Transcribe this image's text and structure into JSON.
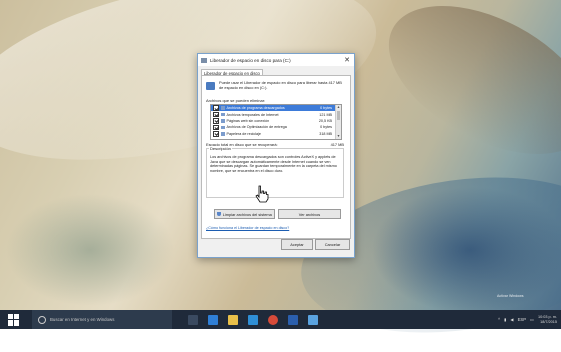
{
  "dialog": {
    "title": "Liberador de espacio en disco para (C:)",
    "close_glyph": "✕",
    "tab": "Liberador de espacio en disco",
    "info_text": "Puede usar el Liberador de espacio en disco para liberar hasta 417 MB de espacio en disco en (C:).",
    "list_label": "Archivos que se pueden eliminar:",
    "files": [
      {
        "name": "Archivos de programa descargados",
        "size": "0 bytes",
        "checked": true,
        "selected": true
      },
      {
        "name": "Archivos temporales de Internet",
        "size": "121 MB",
        "checked": true,
        "selected": false
      },
      {
        "name": "Páginas web sin conexión",
        "size": "20,5 KB",
        "checked": true,
        "selected": false
      },
      {
        "name": "Archivos de Optimización de entrega",
        "size": "0 bytes",
        "checked": true,
        "selected": false
      },
      {
        "name": "Papelera de reciclaje",
        "size": "318 MB",
        "checked": true,
        "selected": false
      }
    ],
    "total_label": "Espacio total en disco que se recuperará:",
    "total_value": "417 MB",
    "description_title": "Descripción",
    "description_text": "Los archivos de programa descargados son controles ActiveX y applets de Java que se descargan automáticamente desde Internet cuando se ven determinadas páginas. Se guardan temporalmente en la carpeta del mismo nombre, que se encuentra en el disco duro.",
    "clean_button": "Limpiar archivos del sistema",
    "view_button": "Ver archivos",
    "link": "¿Cómo funciona el Liberador de espacio en disco?",
    "ok_button": "Aceptar",
    "cancel_button": "Cancelar"
  },
  "taskbar": {
    "search_placeholder": "Buscar en Internet y en Windows",
    "language": "ESP",
    "time": "10:03 p. m.",
    "date": "18/7/2015",
    "apps": [
      {
        "name": "task-view-icon",
        "color": "#3a4a60"
      },
      {
        "name": "edge-icon",
        "color": "#2f7fd6"
      },
      {
        "name": "file-explorer-icon",
        "color": "#e8c04a"
      },
      {
        "name": "store-icon",
        "color": "#2f8fd6"
      },
      {
        "name": "chrome-icon",
        "color": "#d64b3a"
      },
      {
        "name": "word-icon",
        "color": "#2b5fad"
      },
      {
        "name": "paint-icon",
        "color": "#5aa3e0"
      }
    ]
  },
  "watermark": "Activar Windows"
}
